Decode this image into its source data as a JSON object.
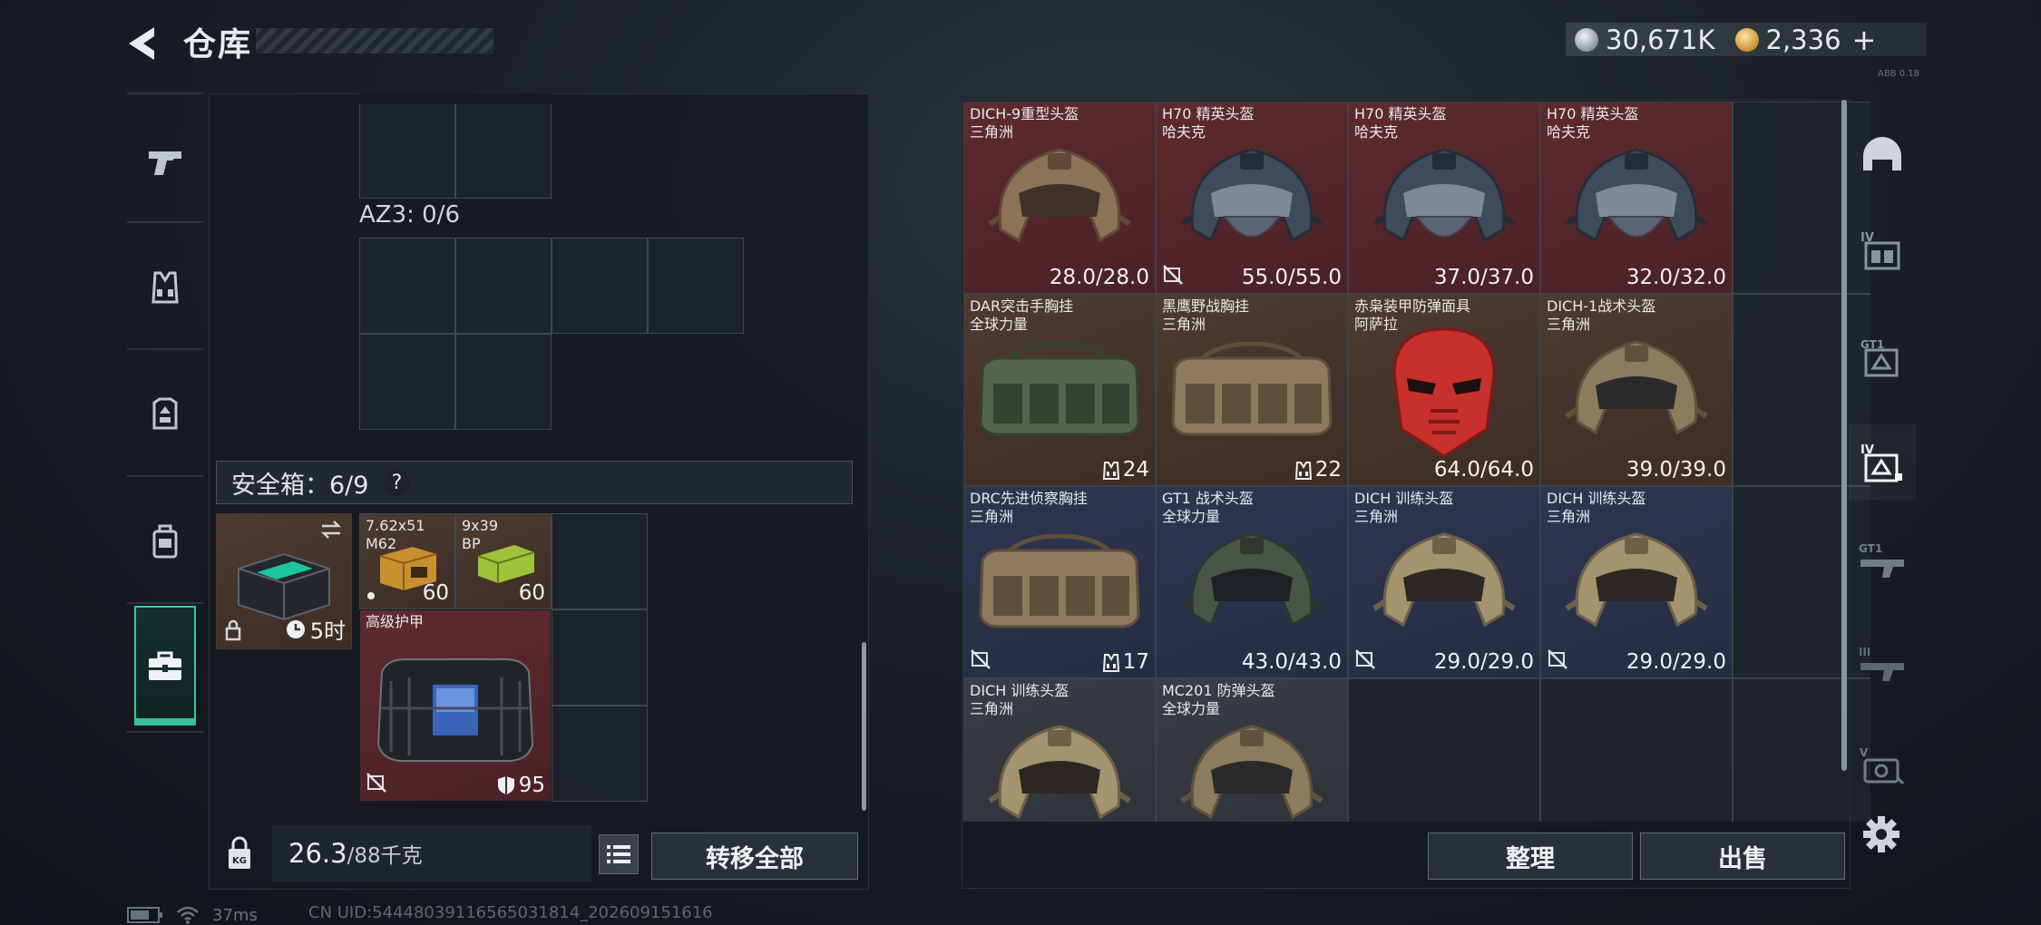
{
  "header": {
    "title": "仓库"
  },
  "currency": {
    "silver": "30,671K",
    "gold": "2,336",
    "add_symbol": "+"
  },
  "corner_tag": "ABB 0.18",
  "left_nav": {
    "items": [
      {
        "id": "weapons",
        "icon": "pistol-icon"
      },
      {
        "id": "chest-rig",
        "icon": "vest-icon"
      },
      {
        "id": "armor",
        "icon": "armor-plate-icon"
      },
      {
        "id": "backpack",
        "icon": "backpack-icon"
      },
      {
        "id": "safebox",
        "icon": "case-icon",
        "selected": true
      }
    ]
  },
  "container": {
    "az3_label": "AZ3: 0/6",
    "safebox_label": "安全箱：6/9",
    "help_symbol": "?",
    "safebox_item": {
      "timer": "5时"
    },
    "items": [
      {
        "name": "7.62x51",
        "sub": "M62",
        "count": "60"
      },
      {
        "name": "9x39",
        "sub": "BP",
        "count": "60"
      },
      {
        "name": "高级护甲",
        "value": "95"
      }
    ],
    "weight_current": "26.3",
    "weight_max": "/88千克",
    "transfer_label": "转移全部"
  },
  "stash": {
    "items": [
      {
        "name": "DICH-9重型头盔",
        "sub": "三角洲",
        "value": "28.0/28.0",
        "rarity": "red",
        "kind": "helmet-tan"
      },
      {
        "name": "H70 精英头盔",
        "sub": "哈夫克",
        "value": "55.0/55.0",
        "rarity": "red",
        "kind": "helmet-black",
        "badge": true
      },
      {
        "name": "H70 精英头盔",
        "sub": "哈夫克",
        "value": "37.0/37.0",
        "rarity": "red",
        "kind": "helmet-black"
      },
      {
        "name": "H70 精英头盔",
        "sub": "哈夫克",
        "value": "32.0/32.0",
        "rarity": "red",
        "kind": "helmet-black"
      },
      {
        "name": "DAR突击手胸挂",
        "sub": "全球力量",
        "value": "24",
        "rarity": "brown",
        "kind": "rig-green",
        "rig": true
      },
      {
        "name": "黑鹰野战胸挂",
        "sub": "三角洲",
        "value": "22",
        "rarity": "brown",
        "kind": "rig-tan",
        "rig": true
      },
      {
        "name": "赤枭装甲防弹面具",
        "sub": "阿萨拉",
        "value": "64.0/64.0",
        "rarity": "brown",
        "kind": "mask-red"
      },
      {
        "name": "DICH-1战术头盔",
        "sub": "三角洲",
        "value": "39.0/39.0",
        "rarity": "brown",
        "kind": "helmet-olive"
      },
      {
        "name": "DRC先进侦察胸挂",
        "sub": "三角洲",
        "value": "17",
        "rarity": "blue",
        "kind": "rig-tan",
        "rig": true,
        "badge": true
      },
      {
        "name": "GT1 战术头盔",
        "sub": "全球力量",
        "value": "43.0/43.0",
        "rarity": "blue",
        "kind": "helmet-green"
      },
      {
        "name": "DICH 训练头盔",
        "sub": "三角洲",
        "value": "29.0/29.0",
        "rarity": "blue",
        "kind": "helmet-sand",
        "badge": true
      },
      {
        "name": "DICH 训练头盔",
        "sub": "三角洲",
        "value": "29.0/29.0",
        "rarity": "blue",
        "kind": "helmet-sand",
        "badge": true
      },
      {
        "name": "DICH 训练头盔",
        "sub": "三角洲",
        "value": "",
        "rarity": "dark",
        "kind": "helmet-sand"
      },
      {
        "name": "MC201 防弹头盔",
        "sub": "全球力量",
        "value": "",
        "rarity": "dark",
        "kind": "helmet-olive"
      }
    ],
    "sort_label": "整理",
    "sell_label": "出售"
  },
  "right_filters": [
    {
      "id": "all",
      "icon": "helmet-filter-icon"
    },
    {
      "id": "IV-vest",
      "icon": "iv-vest-filter-icon"
    },
    {
      "id": "GT1-armor",
      "icon": "gt1-armor-filter-icon"
    },
    {
      "id": "IV-helmet",
      "icon": "iv-helmet-filter-icon",
      "selected": true
    },
    {
      "id": "GT1-weapon",
      "icon": "gt1-weapon-filter-icon"
    },
    {
      "id": "III-weapon",
      "icon": "iii-weapon-filter-icon"
    },
    {
      "id": "V-equipment",
      "icon": "v-equipment-filter-icon"
    }
  ],
  "status": {
    "ping": "37ms",
    "uid": "CN UID:5444803911656503181​4_202609151616"
  }
}
